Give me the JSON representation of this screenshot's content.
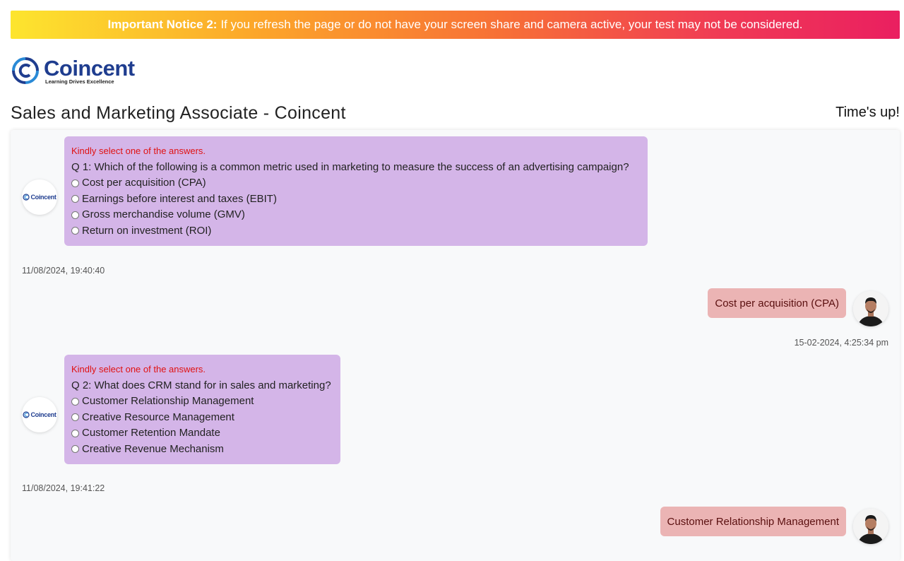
{
  "notice": {
    "bold": "Important Notice 2:",
    "text": "If you refresh the page or do not have your screen share and camera active, your test may not be considered."
  },
  "logo": {
    "name": "Coincent",
    "tagline": "Learning Drives Excellence"
  },
  "page": {
    "title": "Sales and Marketing Associate - Coincent",
    "timer": "Time's up!"
  },
  "colors": {
    "brand": "#1f3d8f",
    "question_bubble": "#d4b5e8",
    "reply_bubble": "#ebb4b4",
    "warning": "#e01111"
  },
  "chat": {
    "q1": {
      "warning": "Kindly select one of the answers.",
      "question": "Q 1: Which of the following is a common metric used in marketing to measure the success of an advertising campaign?",
      "options": [
        "Cost per acquisition (CPA)",
        "Earnings before interest and taxes (EBIT)",
        "Gross merchandise volume (GMV)",
        "Return on investment (ROI)"
      ],
      "timestamp": "11/08/2024, 19:40:40",
      "reply": "Cost per acquisition (CPA)",
      "reply_timestamp": "15-02-2024, 4:25:34 pm"
    },
    "q2": {
      "warning": "Kindly select one of the answers.",
      "question": "Q 2: What does CRM stand for in sales and marketing?",
      "options": [
        "Customer Relationship Management",
        "Creative Resource Management",
        "Customer Retention Mandate",
        "Creative Revenue Mechanism"
      ],
      "timestamp": "11/08/2024, 19:41:22",
      "reply": "Customer Relationship Management"
    },
    "bot_logo_text": "Coincent"
  }
}
